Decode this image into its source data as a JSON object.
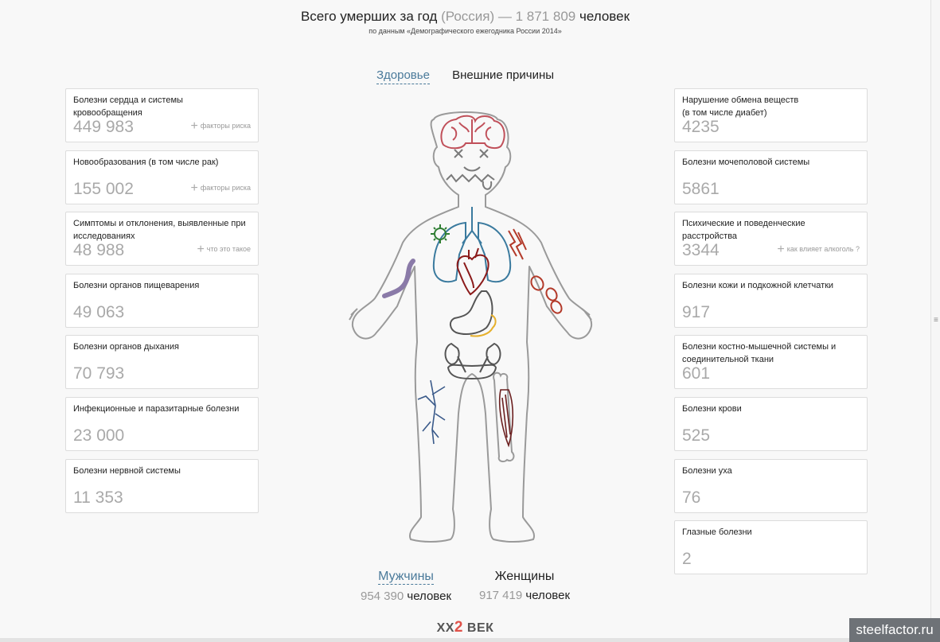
{
  "header": {
    "title_prefix": "Всего умерших за год ",
    "title_region": "(Россия)",
    "title_dash": " — ",
    "title_total": "1 871 809",
    "title_suffix": " человек",
    "subtitle": "по данным «Демографического ежегодника России 2014»"
  },
  "tabs": [
    {
      "label": "Здоровье",
      "active": true
    },
    {
      "label": "Внешние причины",
      "active": false
    }
  ],
  "left_cards": [
    {
      "label": "Болезни сердца и системы кровообращения",
      "value": "449 983",
      "extra": "факторы риска"
    },
    {
      "label": "Новообразования (в том числе рак)",
      "value": "155 002",
      "extra": "факторы риска"
    },
    {
      "label": "Симптомы и отклонения, выявленные при исследованиях",
      "value": "48 988",
      "extra": "что это такое"
    },
    {
      "label": "Болезни органов пищеварения",
      "value": "49 063",
      "extra": ""
    },
    {
      "label": "Болезни органов дыхания",
      "value": "70 793",
      "extra": ""
    },
    {
      "label": "Инфекционные и паразитарные болезни",
      "value": "23 000",
      "extra": ""
    },
    {
      "label": "Болезни нервной системы",
      "value": "11 353",
      "extra": ""
    }
  ],
  "right_cards": [
    {
      "label": "Нарушение обмена веществ\n(в том числе диабет)",
      "value": "4235",
      "extra": ""
    },
    {
      "label": "Болезни мочеполовой системы",
      "value": "5861",
      "extra": ""
    },
    {
      "label": "Психические и поведенческие расстройства",
      "value": "3344",
      "extra": "как влияет алкоголь ?"
    },
    {
      "label": "Болезни кожи и подкожной клетчатки",
      "value": "917",
      "extra": ""
    },
    {
      "label": "Болезни костно-мышечной системы и соединительной ткани",
      "value": "601",
      "extra": ""
    },
    {
      "label": "Болезни крови",
      "value": "525",
      "extra": ""
    },
    {
      "label": "Болезни уха",
      "value": "76",
      "extra": ""
    },
    {
      "label": "Глазные болезни",
      "value": "2",
      "extra": ""
    }
  ],
  "genders": [
    {
      "label": "Мужчины",
      "count": "954 390",
      "unit": " человек",
      "active": true
    },
    {
      "label": "Женщины",
      "count": "917 419",
      "unit": " человек",
      "active": false
    }
  ],
  "logo": {
    "left": "XX",
    "mid": "2",
    "right": " ВЕК"
  },
  "watermark": "steelfactor.ru",
  "colors": {
    "accent": "#4a7a9a",
    "brain": "#c0505a",
    "heart": "#8b1a1a",
    "lungs": "#3a7a9e",
    "stomach": "#555555",
    "pancreas": "#e6b02c",
    "worm": "#8a7aa8",
    "virus": "#2e7d32",
    "nerve": "#3a5a8a",
    "muscle": "#6b1f1f",
    "skin": "#b33a2a",
    "logo_two": "#e0524a"
  },
  "icons": [
    "plus-icon",
    "body-outline-icon",
    "brain-icon",
    "face-icon",
    "lungs-icon",
    "heart-icon",
    "stomach-icon",
    "kidneys-icon",
    "worm-icon",
    "virus-icon",
    "nerve-icon",
    "bone-icon",
    "muscle-icon",
    "skin-icon"
  ]
}
